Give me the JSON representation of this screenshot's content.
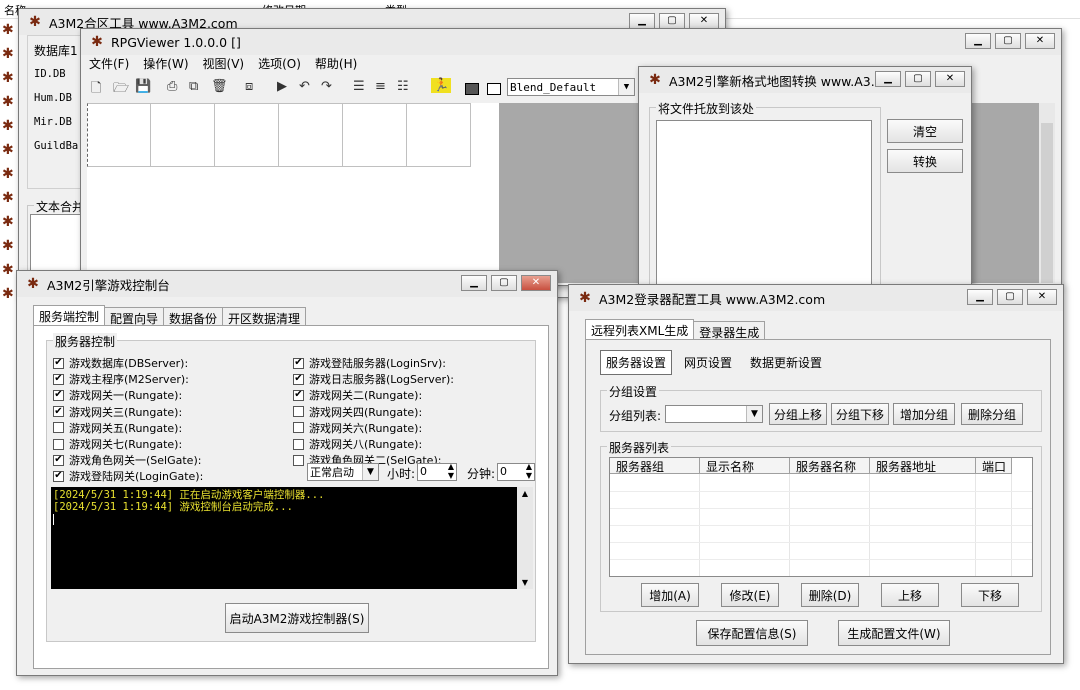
{
  "bg": {
    "col1": "名称",
    "col2": "修改日期",
    "col3": "类型",
    "side_icons": 12
  },
  "hefu": {
    "title": "A3M2合区工具 www.A3M2.com",
    "label_db": "数据库1",
    "db_items": [
      "ID.DB",
      "Hum.DB",
      "Mir.DB",
      "GuildBa"
    ],
    "group_text": "文本合并"
  },
  "rpg": {
    "title": "RPGViewer 1.0.0.0 []",
    "menu": [
      "文件(F)",
      "操作(W)",
      "视图(V)",
      "选项(O)",
      "帮助(H)"
    ],
    "blend_value": "Blend_Default"
  },
  "mapconv": {
    "title": "A3M2引擎新格式地图转换 www.A3...",
    "group_label": "将文件托放到该处",
    "clear_btn": "清空",
    "convert_btn": "转换"
  },
  "console": {
    "title": "A3M2引擎游戏控制台",
    "tabs": [
      "服务端控制",
      "配置向导",
      "数据备份",
      "开区数据清理"
    ],
    "group_label": "服务器控制",
    "checks_left": [
      {
        "label": "游戏数据库(DBServer):",
        "checked": true
      },
      {
        "label": "游戏主程序(M2Server):",
        "checked": true
      },
      {
        "label": "游戏网关一(Rungate):",
        "checked": true
      },
      {
        "label": "游戏网关三(Rungate):",
        "checked": true
      },
      {
        "label": "游戏网关五(Rungate):",
        "checked": false
      },
      {
        "label": "游戏网关七(Rungate):",
        "checked": false
      },
      {
        "label": "游戏角色网关一(SelGate):",
        "checked": true
      },
      {
        "label": "游戏登陆网关(LoginGate):",
        "checked": true
      }
    ],
    "checks_right": [
      {
        "label": "游戏登陆服务器(LoginSrv):",
        "checked": true
      },
      {
        "label": "游戏日志服务器(LogServer):",
        "checked": true
      },
      {
        "label": "游戏网关二(Rungate):",
        "checked": true
      },
      {
        "label": "游戏网关四(Rungate):",
        "checked": false
      },
      {
        "label": "游戏网关六(Rungate):",
        "checked": false
      },
      {
        "label": "游戏网关八(Rungate):",
        "checked": false
      },
      {
        "label": "游戏角色网关二(SelGate):",
        "checked": false
      }
    ],
    "start_mode": "正常启动",
    "hour_label": "小时:",
    "hour_value": "0",
    "minute_label": "分钟:",
    "minute_value": "0",
    "log": [
      "[2024/5/31 1:19:44] 正在启动游戏客户端控制器...",
      "[2024/5/31 1:19:44] 游戏控制台启动完成..."
    ],
    "log_color": "#e8e030",
    "start_button": "启动A3M2游戏控制器(S)"
  },
  "login": {
    "title": "A3M2登录器配置工具 www.A3M2.com",
    "tabs": [
      "远程列表XML生成",
      "登录器生成"
    ],
    "subtabs": [
      "服务器设置",
      "网页设置",
      "数据更新设置"
    ],
    "group_label": "分组设置",
    "group_list_label": "分组列表:",
    "group_buttons": [
      "分组上移",
      "分组下移",
      "增加分组",
      "删除分组"
    ],
    "server_group_label": "服务器列表",
    "columns": [
      "服务器组",
      "显示名称",
      "服务器名称",
      "服务器地址",
      "端口"
    ],
    "row_buttons": [
      "增加(A)",
      "修改(E)",
      "删除(D)",
      "上移",
      "下移"
    ],
    "save_button": "保存配置信息(S)",
    "gen_button": "生成配置文件(W)"
  },
  "colors": {
    "console_bg": "#000000",
    "logo": "#7a2a10"
  }
}
